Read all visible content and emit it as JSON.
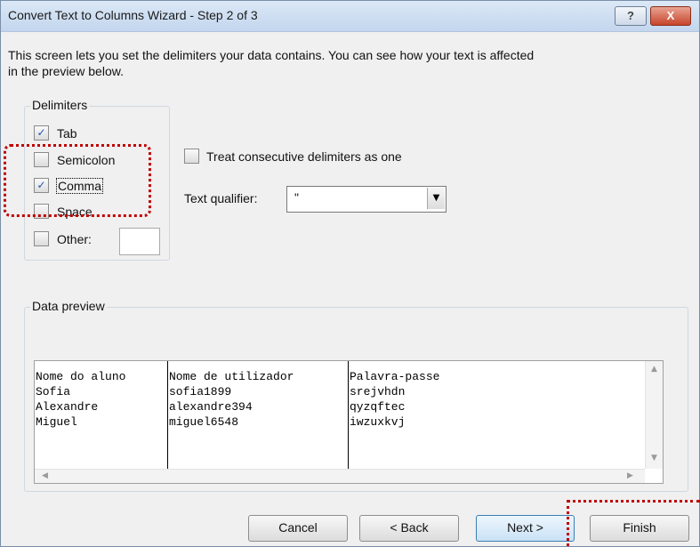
{
  "window": {
    "title": "Convert Text to Columns Wizard - Step 2 of 3",
    "help_label": "?",
    "close_label": "X"
  },
  "intro": {
    "line1": "This screen lets you set the delimiters your data contains.  You can see how your text is affected",
    "line2": "in the preview below."
  },
  "delimiters": {
    "legend": "Delimiters",
    "items": [
      {
        "label": "Tab",
        "checked": true
      },
      {
        "label": "Semicolon",
        "checked": false
      },
      {
        "label": "Comma",
        "checked": true
      },
      {
        "label": "Space",
        "checked": false
      },
      {
        "label": "Other:",
        "checked": false
      }
    ],
    "other_value": ""
  },
  "treat_consecutive": {
    "label": "Treat consecutive delimiters as one",
    "checked": false
  },
  "text_qualifier": {
    "label": "Text qualifier:",
    "value": "\""
  },
  "data_preview": {
    "legend": "Data preview",
    "rows": [
      [
        "Nome do aluno",
        "Nome de utilizador",
        "Palavra-passe"
      ],
      [
        "Sofia",
        "sofia1899",
        "srejvhdn"
      ],
      [
        "Alexandre",
        "alexandre394",
        "qyzqftec"
      ],
      [
        "Miguel",
        "miguel6548",
        "iwzuxkvj"
      ]
    ]
  },
  "buttons": {
    "cancel": "Cancel",
    "back": "< Back",
    "next": "Next >",
    "finish": "Finish"
  },
  "colors": {
    "annotation": "#c00000",
    "check": "#1f55b8"
  }
}
